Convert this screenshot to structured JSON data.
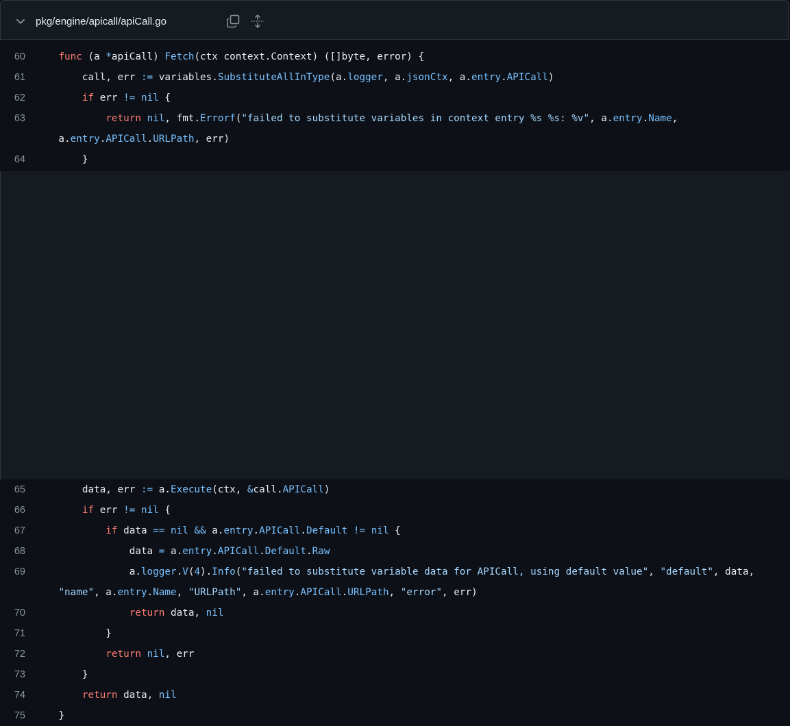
{
  "file": {
    "path": "pkg/engine/apicall/apiCall.go"
  },
  "icons": [
    "chevron-down-icon",
    "copy-icon",
    "expand-icon"
  ],
  "colors": {
    "keyword": "#ff7b72",
    "function": "#79c0ff",
    "string": "#a5d6ff",
    "text": "#e6edf3",
    "line_number": "#8b949e"
  },
  "code": {
    "l60": {
      "num": "60",
      "indent": "    ",
      "t": [
        [
          "func",
          "k"
        ],
        [
          " (a ",
          ""
        ],
        [
          "*",
          "f"
        ],
        [
          "apiCall) ",
          ""
        ],
        [
          "Fetch",
          "f"
        ],
        [
          "(ctx context.Context) ([]byte, error) {",
          ""
        ]
      ]
    },
    "l61": {
      "num": "61",
      "indent": "        ",
      "t": [
        [
          "call, err ",
          ""
        ],
        [
          ":=",
          "f"
        ],
        [
          " variables.",
          ""
        ],
        [
          "SubstituteAllInType",
          "f"
        ],
        [
          "(a.",
          ""
        ],
        [
          "logger",
          "f"
        ],
        [
          ", a.",
          ""
        ],
        [
          "jsonCtx",
          "f"
        ],
        [
          ", a.",
          ""
        ],
        [
          "entry",
          "f"
        ],
        [
          ".",
          ""
        ],
        [
          "APICall",
          "f"
        ],
        [
          ")",
          ""
        ]
      ]
    },
    "l62": {
      "num": "62",
      "indent": "        ",
      "t": [
        [
          "if",
          "k"
        ],
        [
          " err ",
          ""
        ],
        [
          "!=",
          "f"
        ],
        [
          " ",
          ""
        ],
        [
          "nil",
          "f"
        ],
        [
          " {",
          ""
        ]
      ]
    },
    "l63": {
      "num": "63",
      "indent": "            ",
      "t": [
        [
          "return",
          "k"
        ],
        [
          " ",
          ""
        ],
        [
          "nil",
          "f"
        ],
        [
          ", fmt.",
          ""
        ],
        [
          "Errorf",
          "f"
        ],
        [
          "(",
          ""
        ],
        [
          "\"failed to substitute variables in context entry %s %s: %v\"",
          "s"
        ],
        [
          ", a.",
          ""
        ],
        [
          "entry",
          "f"
        ],
        [
          ".",
          ""
        ],
        [
          "Name",
          "f"
        ],
        [
          ",",
          ""
        ]
      ]
    },
    "l63b": {
      "num": "",
      "indent": "",
      "t": [
        [
          "    a.",
          ""
        ],
        [
          "entry",
          "f"
        ],
        [
          ".",
          ""
        ],
        [
          "APICall",
          "f"
        ],
        [
          ".",
          ""
        ],
        [
          "URLPath",
          "f"
        ],
        [
          ", err)",
          ""
        ]
      ]
    },
    "l64": {
      "num": "64",
      "indent": "        ",
      "t": [
        [
          "}",
          ""
        ]
      ]
    },
    "l65": {
      "num": "65",
      "indent": "        ",
      "t": [
        [
          "data, err ",
          ""
        ],
        [
          ":=",
          "f"
        ],
        [
          " a.",
          ""
        ],
        [
          "Execute",
          "f"
        ],
        [
          "(ctx, ",
          ""
        ],
        [
          "&",
          "f"
        ],
        [
          "call.",
          ""
        ],
        [
          "APICall",
          "f"
        ],
        [
          ")",
          ""
        ]
      ]
    },
    "l66": {
      "num": "66",
      "indent": "        ",
      "t": [
        [
          "if",
          "k"
        ],
        [
          " err ",
          ""
        ],
        [
          "!=",
          "f"
        ],
        [
          " ",
          ""
        ],
        [
          "nil",
          "f"
        ],
        [
          " {",
          ""
        ]
      ]
    },
    "l67": {
      "num": "67",
      "indent": "            ",
      "t": [
        [
          "if",
          "k"
        ],
        [
          " data ",
          ""
        ],
        [
          "==",
          "f"
        ],
        [
          " ",
          ""
        ],
        [
          "nil",
          "f"
        ],
        [
          " ",
          ""
        ],
        [
          "&&",
          "f"
        ],
        [
          " a.",
          ""
        ],
        [
          "entry",
          "f"
        ],
        [
          ".",
          ""
        ],
        [
          "APICall",
          "f"
        ],
        [
          ".",
          ""
        ],
        [
          "Default",
          "f"
        ],
        [
          " ",
          ""
        ],
        [
          "!=",
          "f"
        ],
        [
          " ",
          ""
        ],
        [
          "nil",
          "f"
        ],
        [
          " {",
          ""
        ]
      ]
    },
    "l68": {
      "num": "68",
      "indent": "                ",
      "t": [
        [
          "data ",
          ""
        ],
        [
          "=",
          "f"
        ],
        [
          " a.",
          ""
        ],
        [
          "entry",
          "f"
        ],
        [
          ".",
          ""
        ],
        [
          "APICall",
          "f"
        ],
        [
          ".",
          ""
        ],
        [
          "Default",
          "f"
        ],
        [
          ".",
          ""
        ],
        [
          "Raw",
          "f"
        ]
      ]
    },
    "l69": {
      "num": "69",
      "indent": "                ",
      "t": [
        [
          "a.",
          ""
        ],
        [
          "logger",
          "f"
        ],
        [
          ".",
          ""
        ],
        [
          "V",
          "f"
        ],
        [
          "(",
          ""
        ],
        [
          "4",
          "f"
        ],
        [
          ").",
          ""
        ],
        [
          "Info",
          "f"
        ],
        [
          "(",
          ""
        ],
        [
          "\"failed to substitute variable data for APICall, using default value\"",
          "s"
        ],
        [
          ", ",
          ""
        ],
        [
          "\"default\"",
          "s"
        ],
        [
          ", data,",
          ""
        ]
      ]
    },
    "l69b": {
      "num": "",
      "indent": "",
      "t": [
        [
          "    ",
          ""
        ],
        [
          "\"name\"",
          "s"
        ],
        [
          ", a.",
          ""
        ],
        [
          "entry",
          "f"
        ],
        [
          ".",
          ""
        ],
        [
          "Name",
          "f"
        ],
        [
          ", ",
          ""
        ],
        [
          "\"URLPath\"",
          "s"
        ],
        [
          ", a.",
          ""
        ],
        [
          "entry",
          "f"
        ],
        [
          ".",
          ""
        ],
        [
          "APICall",
          "f"
        ],
        [
          ".",
          ""
        ],
        [
          "URLPath",
          "f"
        ],
        [
          ", ",
          ""
        ],
        [
          "\"error\"",
          "s"
        ],
        [
          ", err)",
          ""
        ]
      ]
    },
    "l70": {
      "num": "70",
      "indent": "                ",
      "t": [
        [
          "return",
          "k"
        ],
        [
          " data, ",
          ""
        ],
        [
          "nil",
          "f"
        ]
      ]
    },
    "l71": {
      "num": "71",
      "indent": "            ",
      "t": [
        [
          "}",
          ""
        ]
      ]
    },
    "l72": {
      "num": "72",
      "indent": "            ",
      "t": [
        [
          "return",
          "k"
        ],
        [
          " ",
          ""
        ],
        [
          "nil",
          "f"
        ],
        [
          ", err",
          ""
        ]
      ]
    },
    "l73": {
      "num": "73",
      "indent": "        ",
      "t": [
        [
          "}",
          ""
        ]
      ]
    },
    "l74": {
      "num": "74",
      "indent": "        ",
      "t": [
        [
          "return",
          "k"
        ],
        [
          " data, ",
          ""
        ],
        [
          "nil",
          "f"
        ]
      ]
    },
    "l75": {
      "num": "75",
      "indent": "    ",
      "t": [
        [
          "}",
          ""
        ]
      ]
    }
  }
}
